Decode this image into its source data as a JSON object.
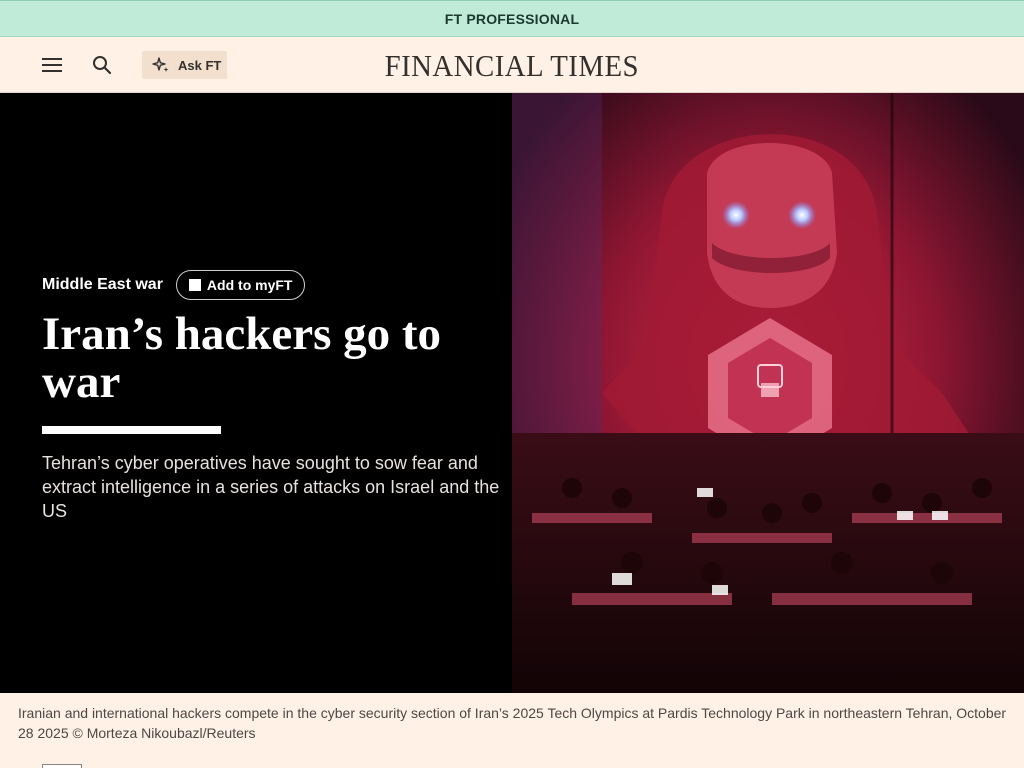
{
  "banner": {
    "label": "FT PROFESSIONAL"
  },
  "header": {
    "menu_icon": "hamburger-menu-icon",
    "search_icon": "search-icon",
    "ask_ft_label": "Ask FT",
    "ask_ft_icon": "sparkle-icon",
    "logo": "FINANCIAL TIMES"
  },
  "article": {
    "topic": "Middle East war",
    "myft_label": "Add to myFT",
    "headline": "Iran’s hackers go to war",
    "standfirst": "Tehran’s cyber operatives have sought to sow fear and extract intelligence in a series of attacks on Israel and the US",
    "caption": "Iranian and international hackers compete in the cyber security section of Iran’s 2025 Tech Olympics at Pardis Technology Park in northeastern Tehran, October 28 2025 © Morteza Nikoubazl/Reuters"
  },
  "colors": {
    "banner_bg": "#c1ebd9",
    "page_bg": "#fff1e5",
    "hero_bg": "#000000",
    "photo_tint": "#c8102e"
  }
}
